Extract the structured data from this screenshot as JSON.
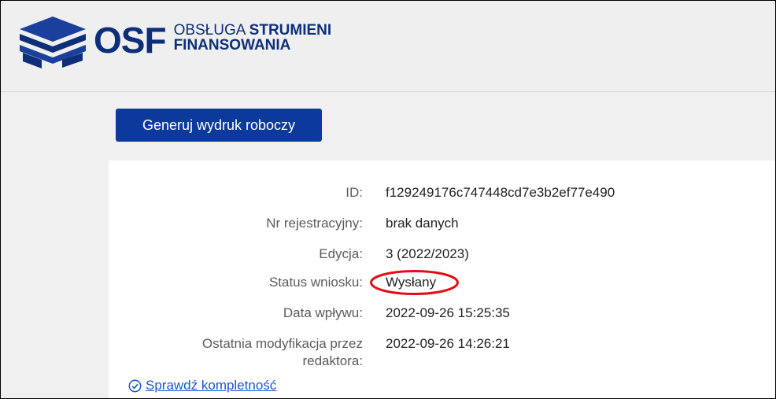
{
  "header": {
    "logo_abbr": "OSF",
    "logo_line1_thin": "OBSŁUGA",
    "logo_line1_bold": "STRUMIENI",
    "logo_line2": "FINANSOWANIA",
    "brand_color": "#0d2f7a"
  },
  "actions": {
    "generate_draft_label": "Generuj wydruk roboczy",
    "button_color": "#0b3a9c"
  },
  "details": [
    {
      "label": "ID:",
      "value": "f129249176c747448cd7e3b2ef77e490"
    },
    {
      "label": "Nr rejestracyjny:",
      "value": "brak danych"
    },
    {
      "label": "Edycja:",
      "value": "3 (2022/2023)"
    },
    {
      "label": "Status wniosku:",
      "value": "Wysłany"
    },
    {
      "label": "Data wpływu:",
      "value": "2022-09-26 15:25:35"
    },
    {
      "label": "Ostatnia modyfikacja przez redaktora:",
      "value": "2022-09-26 14:26:21"
    }
  ],
  "check_link": {
    "label": "Sprawdź kompletność",
    "icon": "check-circle-icon"
  },
  "annotation": {
    "highlight_color": "#e0101a"
  }
}
